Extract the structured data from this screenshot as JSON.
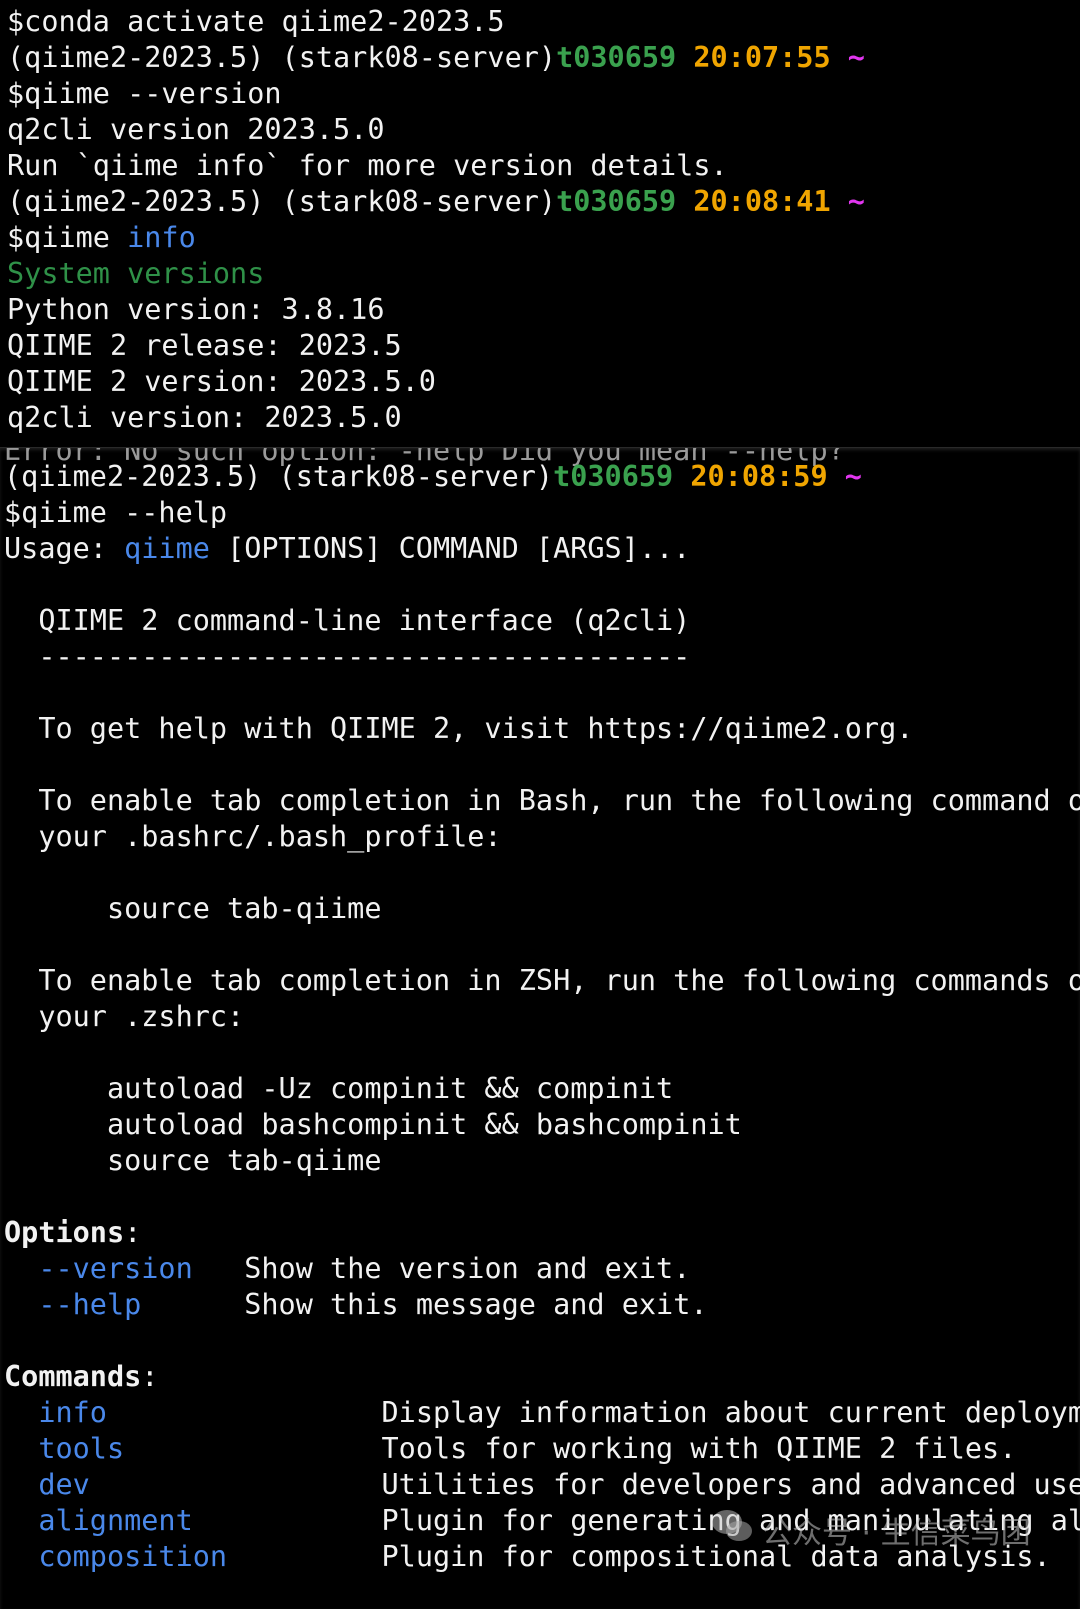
{
  "colors": {
    "w": "#f2f2f2",
    "g": "#3aa14e",
    "o": "#f0a500",
    "m": "#e236f0",
    "b": "#4a88ea",
    "dg": "#2f9148",
    "ghost": "#9a9a9a"
  },
  "top_terminal": {
    "lines": [
      [
        {
          "t": "$conda activate qiime2-2023.5",
          "c": "w"
        }
      ],
      [
        {
          "t": "(qiime2-2023.5) (stark08-server)",
          "c": "w"
        },
        {
          "t": "t030659",
          "c": "g",
          "b": true
        },
        {
          "t": " ",
          "c": "w"
        },
        {
          "t": "20:07:55",
          "c": "o",
          "b": true
        },
        {
          "t": " ~",
          "c": "m",
          "b": true
        }
      ],
      [
        {
          "t": "$qiime --version",
          "c": "w"
        }
      ],
      [
        {
          "t": "q2cli version 2023.5.0",
          "c": "w"
        }
      ],
      [
        {
          "t": "Run `qiime info` for more version details.",
          "c": "w"
        }
      ],
      [
        {
          "t": "(qiime2-2023.5) (stark08-server)",
          "c": "w"
        },
        {
          "t": "t030659",
          "c": "g",
          "b": true
        },
        {
          "t": " ",
          "c": "w"
        },
        {
          "t": "20:08:41",
          "c": "o",
          "b": true
        },
        {
          "t": " ~",
          "c": "m",
          "b": true
        }
      ],
      [
        {
          "t": "$qiime ",
          "c": "w"
        },
        {
          "t": "info",
          "c": "b"
        }
      ],
      [
        {
          "t": "System versions",
          "c": "dg"
        }
      ],
      [
        {
          "t": "Python version: 3.8.16",
          "c": "w"
        }
      ],
      [
        {
          "t": "QIIME 2 release: 2023.5",
          "c": "w"
        }
      ],
      [
        {
          "t": "QIIME 2 version: 2023.5.0",
          "c": "w"
        }
      ],
      [
        {
          "t": "q2cli version: 2023.5.0",
          "c": "w"
        }
      ]
    ]
  },
  "bottom_terminal": {
    "clipped_line": "Error: No such option: -help Did you mean --help?",
    "lines": [
      [
        {
          "t": "(qiime2-2023.5) (stark08-server)",
          "c": "w"
        },
        {
          "t": "t030659",
          "c": "g",
          "b": true
        },
        {
          "t": " ",
          "c": "w"
        },
        {
          "t": "20:08:59",
          "c": "o",
          "b": true
        },
        {
          "t": " ~",
          "c": "m",
          "b": true
        }
      ],
      [
        {
          "t": "$qiime --help",
          "c": "w"
        }
      ],
      [
        {
          "t": "Usage: ",
          "c": "w"
        },
        {
          "t": "qiime",
          "c": "b"
        },
        {
          "t": " [OPTIONS] COMMAND [ARGS]...",
          "c": "w"
        }
      ],
      [],
      [
        {
          "t": "  QIIME 2 command-line interface (q2cli)",
          "c": "w"
        }
      ],
      [
        {
          "t": "  --------------------------------------",
          "c": "w"
        }
      ],
      [],
      [
        {
          "t": "  To get help with QIIME 2, visit https://qiime2.org.",
          "c": "w"
        }
      ],
      [],
      [
        {
          "t": "  To enable tab completion in Bash, run the following command or add it to",
          "c": "w"
        }
      ],
      [
        {
          "t": "  your .bashrc/.bash_profile:",
          "c": "w"
        }
      ],
      [],
      [
        {
          "t": "      source tab-qiime",
          "c": "w"
        }
      ],
      [],
      [
        {
          "t": "  To enable tab completion in ZSH, run the following commands or add them to",
          "c": "w"
        }
      ],
      [
        {
          "t": "  your .zshrc:",
          "c": "w"
        }
      ],
      [],
      [
        {
          "t": "      autoload -Uz compinit && compinit",
          "c": "w"
        }
      ],
      [
        {
          "t": "      autoload bashcompinit && bashcompinit",
          "c": "w"
        }
      ],
      [
        {
          "t": "      source tab-qiime",
          "c": "w"
        }
      ],
      [],
      [
        {
          "t": "Options",
          "c": "w",
          "b": true
        },
        {
          "t": ":",
          "c": "w"
        }
      ],
      [
        {
          "t": "  ",
          "c": "w"
        },
        {
          "t": "--version",
          "c": "b"
        },
        {
          "t": "   Show the version and exit.",
          "c": "w"
        }
      ],
      [
        {
          "t": "  ",
          "c": "w"
        },
        {
          "t": "--help",
          "c": "b"
        },
        {
          "t": "      Show this message and exit.",
          "c": "w"
        }
      ],
      [],
      [
        {
          "t": "Commands",
          "c": "w",
          "b": true
        },
        {
          "t": ":",
          "c": "w"
        }
      ],
      [
        {
          "t": "  ",
          "c": "w"
        },
        {
          "t": "info",
          "c": "b"
        },
        {
          "t": "                Display information about current deployment.",
          "c": "w"
        }
      ],
      [
        {
          "t": "  ",
          "c": "w"
        },
        {
          "t": "tools",
          "c": "b"
        },
        {
          "t": "               Tools for working with QIIME 2 files.",
          "c": "w"
        }
      ],
      [
        {
          "t": "  ",
          "c": "w"
        },
        {
          "t": "dev",
          "c": "b"
        },
        {
          "t": "                 Utilities for developers and advanced users.",
          "c": "w"
        }
      ],
      [
        {
          "t": "  ",
          "c": "w"
        },
        {
          "t": "alignment",
          "c": "b"
        },
        {
          "t": "           Plugin for generating and manipulating alignments.",
          "c": "w"
        }
      ],
      [
        {
          "t": "  ",
          "c": "w"
        },
        {
          "t": "composition",
          "c": "b"
        },
        {
          "t": "         Plugin for compositional data analysis.",
          "c": "w"
        }
      ]
    ]
  },
  "watermark": {
    "icon": "wechat-icon",
    "text": "公众号 · 生信菜鸟团"
  }
}
